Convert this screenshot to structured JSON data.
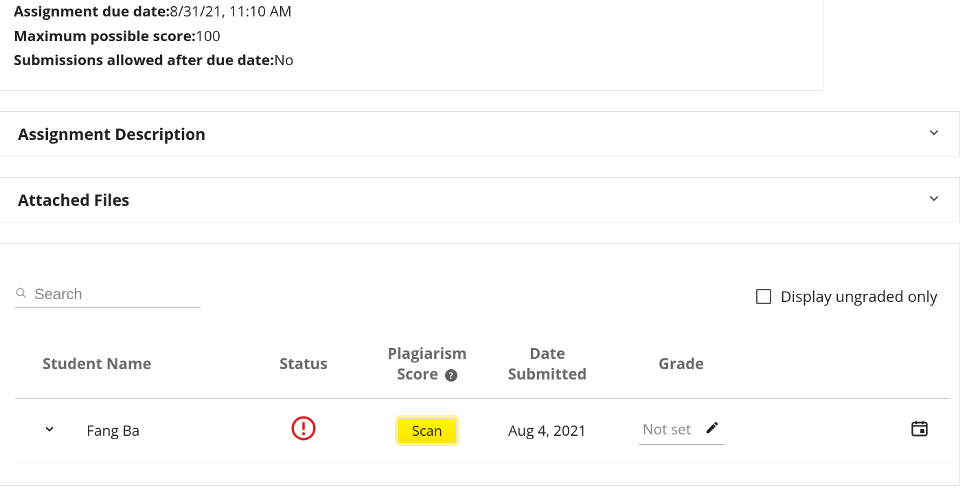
{
  "meta": {
    "due_date_label": "Assignment due date:",
    "due_date_value": "8/31/21, 11:10 AM",
    "max_score_label": "Maximum possible score:",
    "max_score_value": "100",
    "after_due_label": "Submissions allowed after due date:",
    "after_due_value": "No"
  },
  "sections": {
    "description_title": "Assignment Description",
    "attached_title": "Attached Files"
  },
  "toolbar": {
    "search_placeholder": "Search",
    "ungraded_label": "Display ungraded only"
  },
  "table": {
    "headers": {
      "name": "Student Name",
      "status": "Status",
      "plagiarism_line1": "Plagiarism",
      "plagiarism_line2": "Score",
      "date_line1": "Date",
      "date_line2": "Submitted",
      "grade": "Grade"
    },
    "rows": [
      {
        "name": "Fang Ba",
        "scan_label": "Scan",
        "date": "Aug 4, 2021",
        "grade": "Not set"
      }
    ]
  }
}
